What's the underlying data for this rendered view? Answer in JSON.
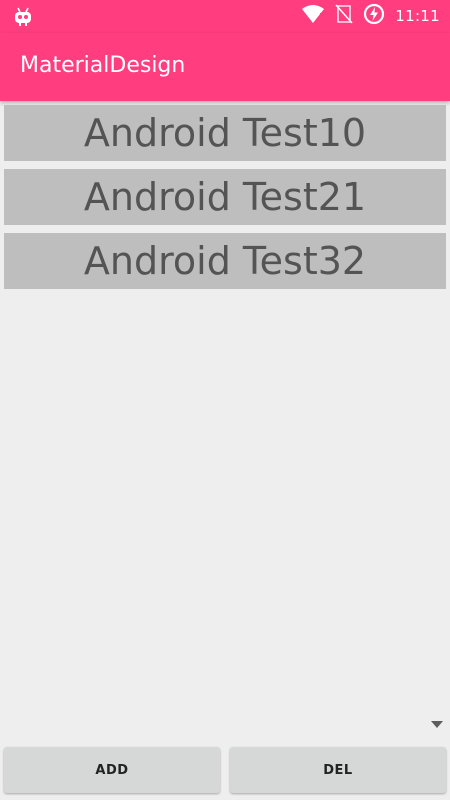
{
  "status_bar": {
    "time": "11:11",
    "icons": [
      "bot-icon",
      "wifi-icon",
      "no-sim-icon",
      "battery-charging-icon"
    ]
  },
  "app_bar": {
    "title": "MaterialDesign"
  },
  "list": {
    "items": [
      {
        "label": "Android Test10"
      },
      {
        "label": "Android Test21"
      },
      {
        "label": "Android Test32"
      }
    ]
  },
  "buttons": {
    "add_label": "ADD",
    "del_label": "DEL"
  },
  "colors": {
    "primary": "#ff3d7f",
    "background": "#eeeeee",
    "list_item": "#bebebe",
    "button": "#d6d7d7"
  }
}
